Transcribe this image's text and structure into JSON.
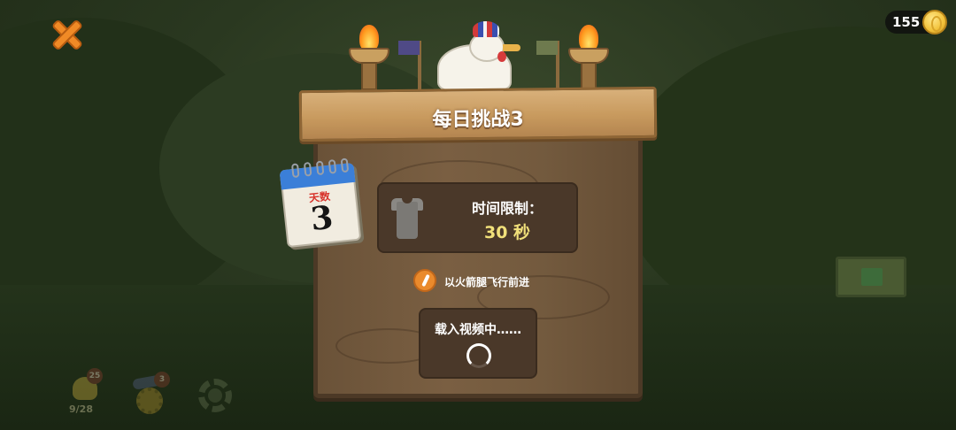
{
  "header": {
    "title": "每日挑战3"
  },
  "coins": {
    "value": "155"
  },
  "calendar": {
    "label": "天数",
    "day": "3"
  },
  "challenge": {
    "time_label": "时间限制：",
    "time_value": "30 秒",
    "hint": "以火箭腿飞行前进"
  },
  "loading": {
    "text": "载入视频中……"
  },
  "bottom_bar": {
    "hero_count": "9/28",
    "hero_badge": "25",
    "cannon_badge": "3"
  },
  "icons": [
    "close-icon",
    "coin-icon",
    "calendar-icon",
    "shirt-icon",
    "rocket-leg-icon",
    "loading-spinner-icon",
    "gear-icon"
  ],
  "colors": {
    "accent": "#f08a26",
    "time_value": "#f1e07a",
    "board": "#735a3e"
  }
}
